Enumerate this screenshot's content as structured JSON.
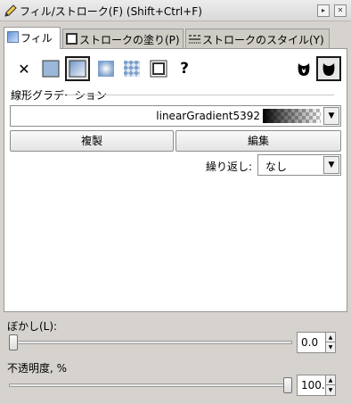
{
  "window": {
    "title": "フィル/ストローク(F) (Shift+Ctrl+F)",
    "restore_glyph": "▸",
    "close_glyph": "✕"
  },
  "tabs": [
    {
      "label": "フィル",
      "active": true
    },
    {
      "label": "ストロークの塗り(P)",
      "active": false
    },
    {
      "label": "ストロークのスタイル(Y)",
      "active": false
    }
  ],
  "paint_types": {
    "none_glyph": "✕",
    "unknown_glyph": "?",
    "selected": "linear-gradient",
    "icons": [
      "none-icon",
      "flat-color-icon",
      "linear-gradient-icon",
      "radial-gradient-icon",
      "pattern-icon",
      "swatch-icon",
      "unset-icon",
      "fill-rule-evenodd-icon",
      "fill-rule-nonzero-icon"
    ]
  },
  "gradient": {
    "section_label": "線形グラデーション",
    "selected_name": "linearGradient5392",
    "duplicate_label": "複製",
    "edit_label": "編集",
    "repeat_label": "繰り返し:",
    "repeat_value": "なし",
    "dropdown_glyph": "▼"
  },
  "blur": {
    "label": "ぼかし(L):",
    "value": "0.0",
    "fraction": 0.0
  },
  "opacity": {
    "label": "不透明度, %",
    "value": "100.0",
    "fraction": 1.0
  },
  "spin_up_glyph": "▲",
  "spin_down_glyph": "▼"
}
